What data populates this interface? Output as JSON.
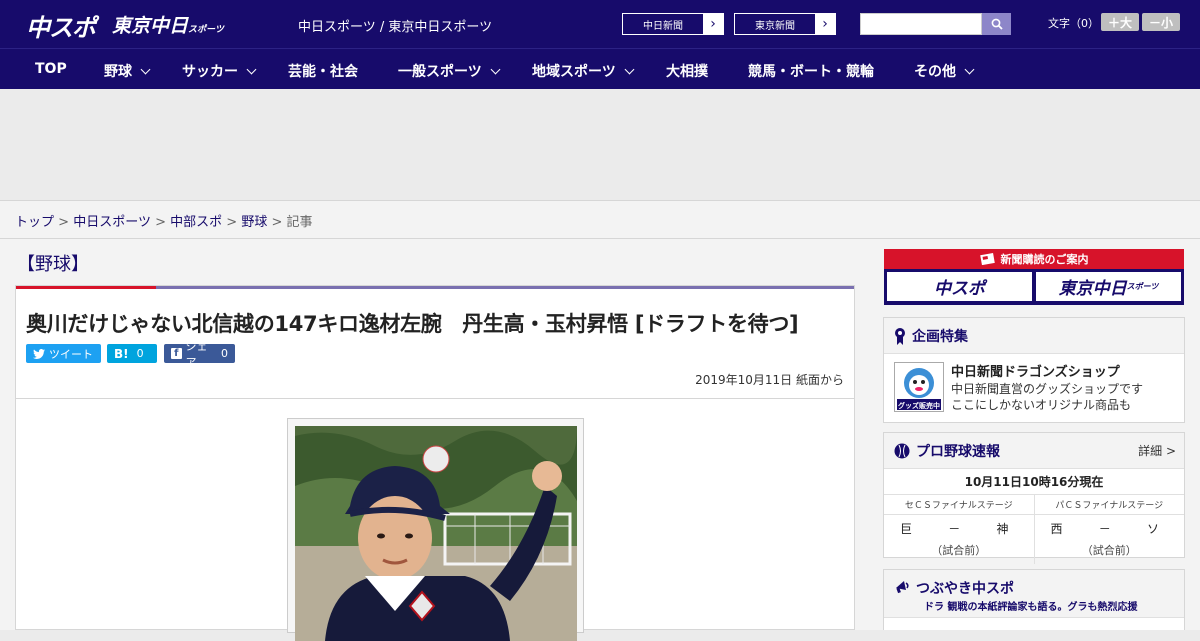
{
  "header": {
    "logo_main": "中スポ",
    "logo_sub": "東京中日",
    "logo_sub_small": "スポーツ",
    "site_title": "中日スポーツ / 東京中日スポーツ",
    "paper_links": [
      "中日新聞",
      "東京新聞"
    ],
    "text_size_label": "文字（0）",
    "text_bigger": "＋大",
    "text_smaller": "－小"
  },
  "nav": {
    "items": [
      {
        "label": "TOP",
        "dropdown": false
      },
      {
        "label": "野球",
        "dropdown": true
      },
      {
        "label": "サッカー",
        "dropdown": true
      },
      {
        "label": "芸能・社会",
        "dropdown": false
      },
      {
        "label": "一般スポーツ",
        "dropdown": true
      },
      {
        "label": "地域スポーツ",
        "dropdown": true
      },
      {
        "label": "大相撲",
        "dropdown": false
      },
      {
        "label": "競馬・ボート・競輪",
        "dropdown": false
      },
      {
        "label": "その他",
        "dropdown": true
      }
    ]
  },
  "breadcrumb": {
    "items": [
      "トップ",
      "中日スポーツ",
      "中部スポ",
      "野球"
    ],
    "current": "記事",
    "separator": ">"
  },
  "article": {
    "category": "【野球】",
    "headline": "奥川だけじゃない北信越の147キロ逸材左腕　丹生高・玉村昇悟 [ドラフトを待つ]",
    "share": {
      "tweet": "ツイート",
      "hatena_count": "0",
      "facebook_label": "シェア",
      "facebook_count": "0"
    },
    "date": "2019年10月11日 紙面から"
  },
  "sidebar": {
    "subscription": {
      "head": "新聞購読のご案内",
      "logo1": "中スポ",
      "logo2": "東京中日",
      "logo2_small": "スポーツ"
    },
    "feature": {
      "title": "企画特集",
      "item_title": "中日新聞ドラゴンズショップ",
      "item_desc1": "中日新聞直営のグッズショップです",
      "item_desc2": "ここにしかないオリジナル商品も",
      "thumb_label": "グッズ販売中"
    },
    "baseball": {
      "title": "プロ野球速報",
      "more": "詳細 >",
      "time": "10月11日10時16分現在",
      "games": [
        {
          "stage": "セＣＳファイナルステージ",
          "home": "巨",
          "dash": "－",
          "away": "神",
          "status": "（試合前）"
        },
        {
          "stage": "パＣＳファイナルステージ",
          "home": "西",
          "dash": "－",
          "away": "ソ",
          "status": "（試合前）"
        }
      ]
    },
    "tweets": {
      "title": "つぶやき中スポ",
      "sub": "ドラ 観戦の本紙評論家も語る。グラも熱烈応援"
    }
  },
  "colors": {
    "brand": "#170b6b",
    "accent_red": "#d7132a",
    "twitter": "#1da1f2",
    "hatena": "#00a4de",
    "facebook": "#3b5998"
  }
}
